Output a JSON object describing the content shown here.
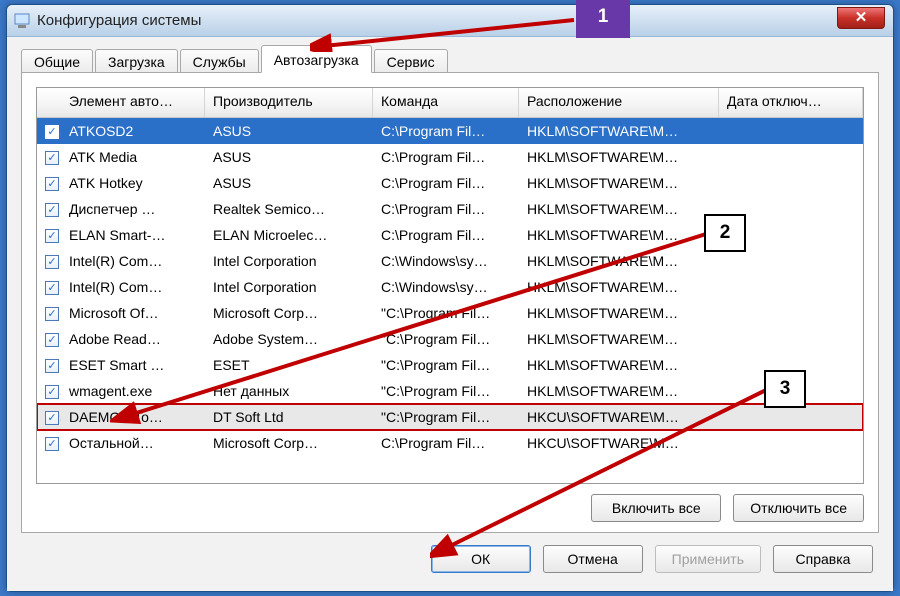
{
  "window": {
    "title": "Конфигурация системы",
    "close_label": "✕"
  },
  "tabs": [
    {
      "label": "Общие",
      "active": false
    },
    {
      "label": "Загрузка",
      "active": false
    },
    {
      "label": "Службы",
      "active": false
    },
    {
      "label": "Автозагрузка",
      "active": true
    },
    {
      "label": "Сервис",
      "active": false
    }
  ],
  "columns": {
    "element": "Элемент авто…",
    "manufacturer": "Производитель",
    "command": "Команда",
    "location": "Расположение",
    "date": "Дата отключ…"
  },
  "rows": [
    {
      "checked": true,
      "element": "ATKOSD2",
      "mf": "ASUS",
      "cmd": "C:\\Program Fil…",
      "loc": "HKLM\\SOFTWARE\\M…",
      "date": "",
      "selected": true
    },
    {
      "checked": true,
      "element": "ATK Media",
      "mf": "ASUS",
      "cmd": "C:\\Program Fil…",
      "loc": "HKLM\\SOFTWARE\\M…",
      "date": ""
    },
    {
      "checked": true,
      "element": "ATK Hotkey",
      "mf": "ASUS",
      "cmd": "C:\\Program Fil…",
      "loc": "HKLM\\SOFTWARE\\M…",
      "date": ""
    },
    {
      "checked": true,
      "element": "Диспетчер …",
      "mf": "Realtek Semico…",
      "cmd": "C:\\Program Fil…",
      "loc": "HKLM\\SOFTWARE\\M…",
      "date": ""
    },
    {
      "checked": true,
      "element": "ELAN Smart-…",
      "mf": "ELAN Microelec…",
      "cmd": "C:\\Program Fil…",
      "loc": "HKLM\\SOFTWARE\\M…",
      "date": ""
    },
    {
      "checked": true,
      "element": "Intel(R) Com…",
      "mf": "Intel Corporation",
      "cmd": "C:\\Windows\\sy…",
      "loc": "HKLM\\SOFTWARE\\M…",
      "date": ""
    },
    {
      "checked": true,
      "element": "Intel(R) Com…",
      "mf": "Intel Corporation",
      "cmd": "C:\\Windows\\sy…",
      "loc": "HKLM\\SOFTWARE\\M…",
      "date": ""
    },
    {
      "checked": true,
      "element": "Microsoft Of…",
      "mf": "Microsoft Corp…",
      "cmd": "\"C:\\Program Fil…",
      "loc": "HKLM\\SOFTWARE\\M…",
      "date": ""
    },
    {
      "checked": true,
      "element": "Adobe Read…",
      "mf": "Adobe System…",
      "cmd": "\"C:\\Program Fil…",
      "loc": "HKLM\\SOFTWARE\\M…",
      "date": ""
    },
    {
      "checked": true,
      "element": "ESET Smart …",
      "mf": "ESET",
      "cmd": "\"C:\\Program Fil…",
      "loc": "HKLM\\SOFTWARE\\M…",
      "date": ""
    },
    {
      "checked": true,
      "element": "wmagent.exe",
      "mf": "Нет данных",
      "cmd": "\"C:\\Program Fil…",
      "loc": "HKLM\\SOFTWARE\\M…",
      "date": ""
    },
    {
      "checked": true,
      "element": "DAEMON To…",
      "mf": "DT Soft Ltd",
      "cmd": "\"C:\\Program Fil…",
      "loc": "HKCU\\SOFTWARE\\M…",
      "date": "",
      "highlighted": true
    },
    {
      "checked": true,
      "element": "Остальной…",
      "mf": "Microsoft Corp…",
      "cmd": "C:\\Program Fil…",
      "loc": "HKCU\\SOFTWARE\\M…",
      "date": ""
    }
  ],
  "pane_buttons": {
    "enable_all": "Включить все",
    "disable_all": "Отключить все"
  },
  "dialog_buttons": {
    "ok": "ОК",
    "cancel": "Отмена",
    "apply": "Применить",
    "help": "Справка"
  },
  "annotations": {
    "a1": "1",
    "a2": "2",
    "a3": "3"
  }
}
